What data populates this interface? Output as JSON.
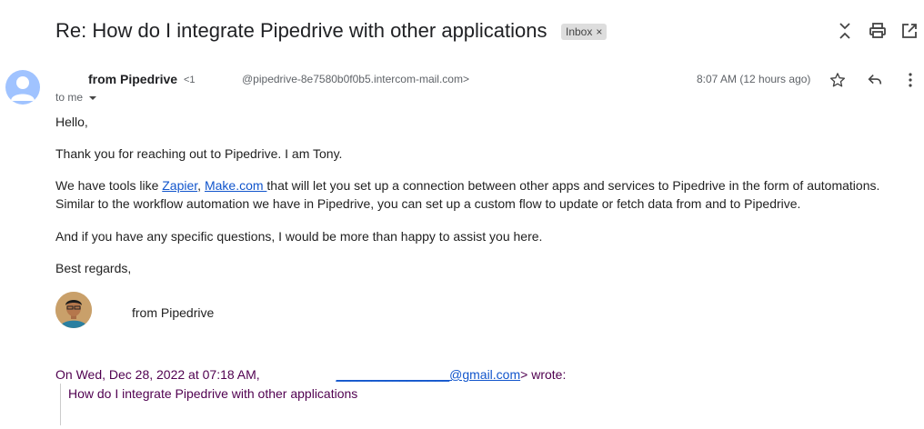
{
  "subject": "Re: How do I integrate Pipedrive with other applications",
  "label_badge": {
    "text": "Inbox",
    "close": "×"
  },
  "toolbar_icons": [
    "expand-collapse-icon",
    "print-icon",
    "open-in-new-window-icon"
  ],
  "message": {
    "sender_name": "from Pipedrive",
    "sender_small": "<1",
    "sender_email": "@pipedrive-8e7580b0f0b5.intercom-mail.com>",
    "time": "8:07 AM (12 hours ago)",
    "to": "to me",
    "action_icons": [
      "star-icon",
      "reply-icon",
      "more-vert-icon"
    ]
  },
  "body": {
    "greeting": "Hello,",
    "p1": "Thank you for reaching out to Pipedrive. I am Tony.",
    "p2_pre": "We have tools like ",
    "link1": "Zapier",
    "p2_sep": ", ",
    "link2": "Make.com ",
    "p2_post": "that will let you set up a connection between other apps and services to Pipedrive in the form of automations. Similar to the workflow automation we have in Pipedrive, you can set up a custom flow to update or fetch data from and to Pipedrive.",
    "p3": "And if you have any specific questions, I would be more than happy to assist you here.",
    "closing": "Best regards,",
    "signature_name": "from Pipedrive"
  },
  "quote": {
    "intro_pre": "On Wed, Dec 28, 2022 at 07:18 AM, ",
    "email_link": "________________@gmail.com",
    "intro_post": "> wrote:",
    "text": "How do I integrate Pipedrive with other applications"
  }
}
